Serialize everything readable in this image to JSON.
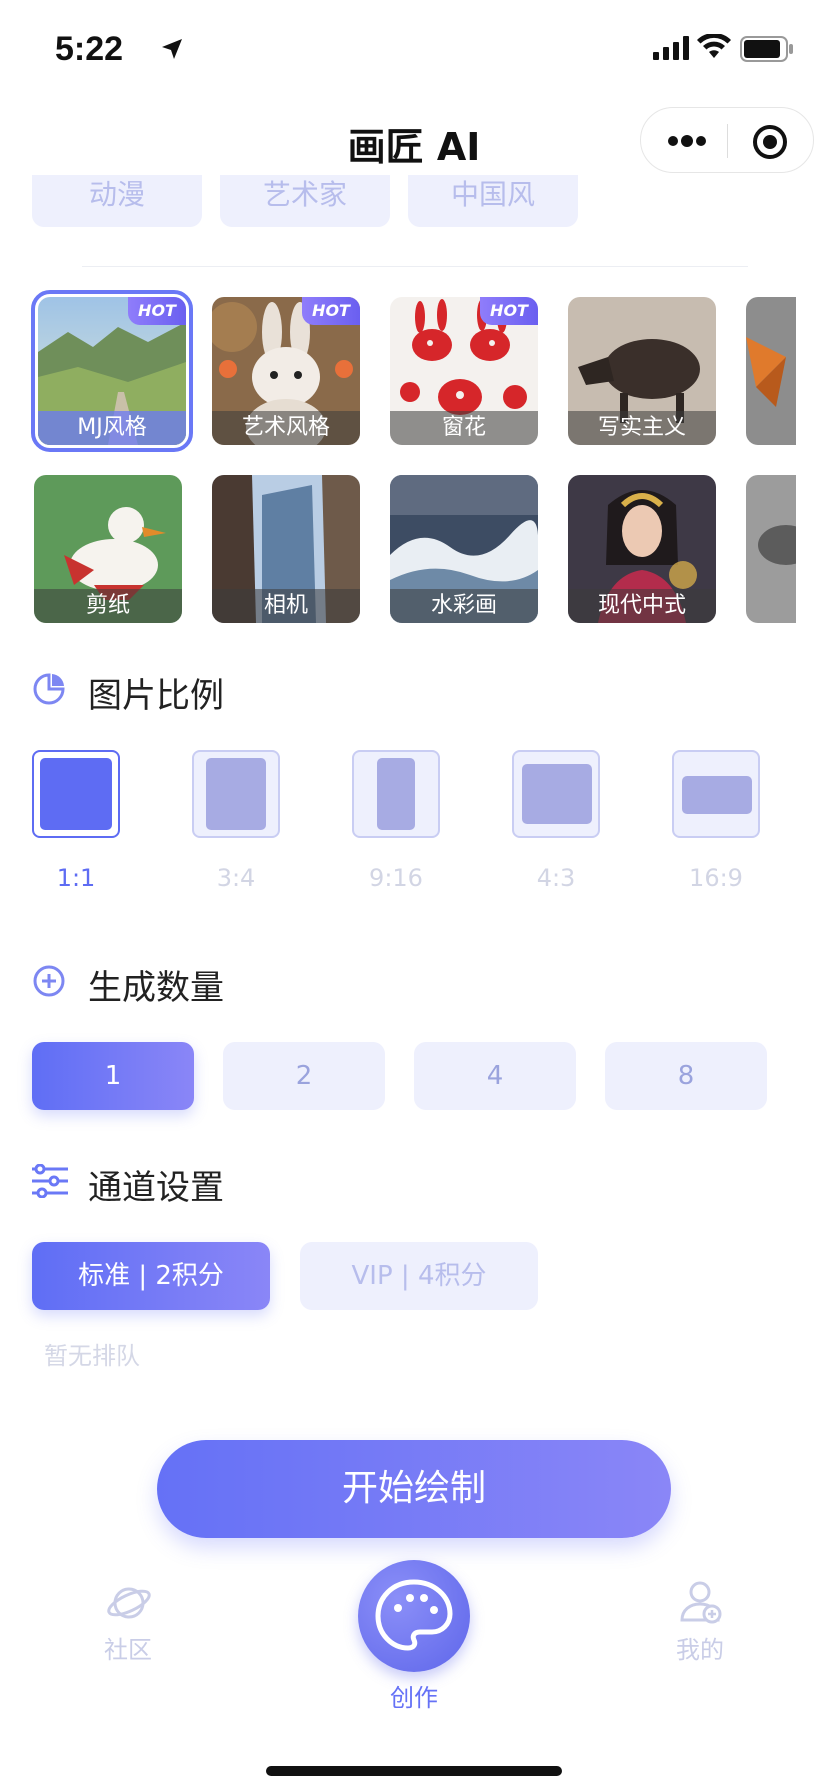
{
  "status_bar": {
    "time": "5:22"
  },
  "header": {
    "title": "画匠 AI"
  },
  "style_tags": [
    "动漫",
    "艺术家",
    "中国风"
  ],
  "style_cards": [
    {
      "label": "MJ风格",
      "hot": "HOT",
      "selected": true
    },
    {
      "label": "艺术风格",
      "hot": "HOT"
    },
    {
      "label": "窗花",
      "hot": "HOT"
    },
    {
      "label": "写实主义"
    },
    {
      "label": ""
    },
    {
      "label": "剪纸"
    },
    {
      "label": "相机"
    },
    {
      "label": "水彩画"
    },
    {
      "label": "现代中式"
    },
    {
      "label": ""
    }
  ],
  "ratio_section": {
    "title": "图片比例",
    "options": [
      "1:1",
      "3:4",
      "9:16",
      "4:3",
      "16:9"
    ],
    "selected": "1:1"
  },
  "count_section": {
    "title": "生成数量",
    "options": [
      "1",
      "2",
      "4",
      "8"
    ],
    "selected": "1"
  },
  "channel_section": {
    "title": "通道设置",
    "options": [
      "标准 | 2积分",
      "VIP | 4积分"
    ],
    "selected": "标准 | 2积分",
    "queue_status": "暂无排队"
  },
  "start_button": {
    "label": "开始绘制"
  },
  "tab_bar": {
    "items": [
      "社区",
      "创作",
      "我的"
    ],
    "active": "创作"
  },
  "colors": {
    "accent": "#5e6cf3",
    "accent_light": "#eef0fd",
    "muted": "#c9cde7"
  }
}
